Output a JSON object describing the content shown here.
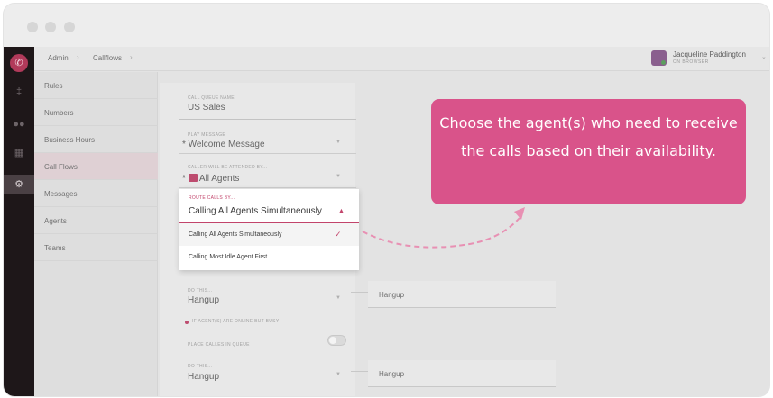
{
  "breadcrumb": {
    "admin": "Admin",
    "callflows": "Callflows"
  },
  "user": {
    "name": "Jacqueline Paddington",
    "status": "ON BROWSER"
  },
  "nav": {
    "items": [
      {
        "label": "Rules"
      },
      {
        "label": "Numbers"
      },
      {
        "label": "Business Hours"
      },
      {
        "label": "Call Flows"
      },
      {
        "label": "Messages"
      },
      {
        "label": "Agents"
      },
      {
        "label": "Teams"
      }
    ],
    "active": "Call Flows"
  },
  "form": {
    "queue_name_label": "CALL QUEUE NAME",
    "queue_name_value": "US Sales",
    "play_message_label": "PLAY MESSAGE",
    "play_message_value": "Welcome Message",
    "attended_label": "CALLER WILL BE ATTENDED BY...",
    "attended_value": "All Agents",
    "route_label": "ROUTE CALLS BY...",
    "route_value": "Calling All Agents Simultaneously",
    "route_options": [
      {
        "label": "Calling All Agents Simultaneously",
        "selected": true
      },
      {
        "label": "Calling Most Idle Agent First",
        "selected": false
      }
    ],
    "do_this_label_1": "DO THIS...",
    "do_this_value_1": "Hangup",
    "busy_label": "IF AGENT(S) ARE ONLINE BUT BUSY",
    "place_queue_label": "PLACE CALLES IN QUEUE",
    "do_this_label_2": "DO THIS...",
    "do_this_value_2": "Hangup",
    "side_box_1": "Hangup",
    "side_box_2": "Hangup"
  },
  "callout": {
    "text": "Choose the agent(s)  who need to receive the calls based on their availability."
  },
  "colors": {
    "accent": "#c2446b",
    "callout": "#d9538a",
    "rail": "#1e1719"
  },
  "icons": {
    "rail": [
      "phone-icon",
      "pin-icon",
      "people-icon",
      "id-card-icon",
      "gear-icon"
    ]
  }
}
